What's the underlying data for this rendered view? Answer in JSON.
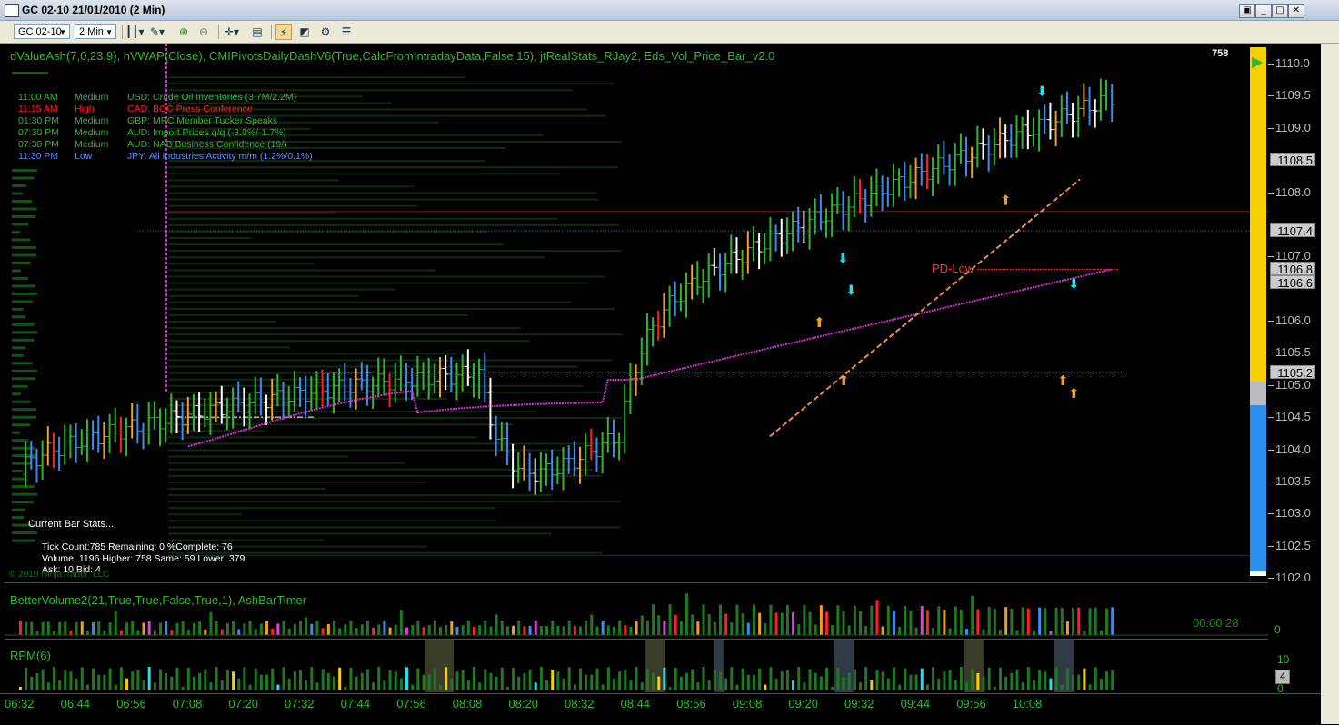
{
  "window": {
    "title": "GC 02-10  21/01/2010 (2 Min)",
    "buttons": [
      "▣",
      "_",
      "□",
      "✕"
    ]
  },
  "toolbar": {
    "instrument": "GC 02-10",
    "interval": "2 Min",
    "icons": [
      "bar-style-icon",
      "drawing-tool-icon",
      "zoom-in-icon",
      "zoom-out-icon",
      "crosshair-icon",
      "data-box-icon",
      "indicators-icon",
      "strategies-icon",
      "properties-icon",
      "hide-icon",
      "list-icon"
    ]
  },
  "price_pane": {
    "indicators_label": "dValueAsh(7,0,23.9), hVWAP(Close), CMIPivotsDailyDashV6(True,CalcFromIntradayData,False,15), jtRealStats_RJay2, Eds_Vol_Price_Bar_v2.0",
    "counter": "758",
    "news": [
      {
        "time": "11:00 AM",
        "impact": "Medium",
        "text": "USD: Crude Oil Inventories (3.7M/2.2M)",
        "color": "#2fb82f"
      },
      {
        "time": "11:15 AM",
        "impact": "High",
        "text": "CAD: BOC Press Conference",
        "color": "#ff2020"
      },
      {
        "time": "01:30 PM",
        "impact": "Medium",
        "text": "GBP: MPC Member Tucker Speaks",
        "color": "#2fb82f"
      },
      {
        "time": "07:30 PM",
        "impact": "Medium",
        "text": "AUD: Import Prices q/q (-3.0%/-1.7%)",
        "color": "#2fb82f"
      },
      {
        "time": "07:30 PM",
        "impact": "Medium",
        "text": "AUD: NAB Business Confidence (19/)",
        "color": "#2fb82f"
      },
      {
        "time": "11:30 PM",
        "impact": "Low",
        "text": "JPY: All Industries Activity m/m (1.2%/0.1%)",
        "color": "#5b8cff"
      }
    ],
    "current_bar_stats_label": "Current Bar Stats...",
    "stats_lines": [
      "Tick Count:785  Remaining: 0  %Complete: 76",
      "Volume: 1196  Higher: 758  Same: 59  Lower: 379",
      "Ask: 10  Bid: 4"
    ],
    "copyright": "© 2010 NinjaTrader, LLC",
    "pd_low_label": "PD-Low",
    "price_ticks": [
      "1110.0",
      "1109.5",
      "1109.0",
      "1108.5",
      "1108.0",
      "1107.4",
      "1107.0",
      "1106.8",
      "1106.6",
      "1106.0",
      "1105.5",
      "1105.2",
      "1105.0",
      "1104.5",
      "1104.0",
      "1103.5",
      "1103.0",
      "1102.5",
      "1102.0"
    ],
    "highlight_prices": [
      "1108.5",
      "1107.4",
      "1106.8",
      "1106.6",
      "1105.2"
    ]
  },
  "volume_pane": {
    "label": "BetterVolume2(21,True,True,False,True,1), AshBarTimer",
    "timer": "00:00:28",
    "zero": "0"
  },
  "rpm_pane": {
    "label": "RPM(6)",
    "ticks": [
      "10",
      "0"
    ],
    "current": "4"
  },
  "time_axis": [
    "06:32",
    "06:44",
    "06:56",
    "07:08",
    "07:20",
    "07:32",
    "07:44",
    "07:56",
    "08:08",
    "08:20",
    "08:32",
    "08:44",
    "08:56",
    "09:08",
    "09:20",
    "09:32",
    "09:44",
    "09:56",
    "10:08"
  ],
  "colors": {
    "up": "#2fb82f",
    "down": "#3b8ef0",
    "vwap": "#d62bd6",
    "trend": "#f08a4b",
    "highlight": "#f0a020",
    "cyan": "#22e0f0",
    "axis_yellow": "#f7d000",
    "axis_blue": "#2b8ff0"
  }
}
